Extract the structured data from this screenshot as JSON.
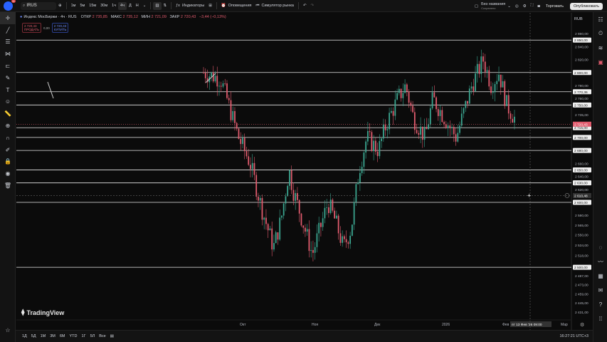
{
  "topbar": {
    "notif_badge": "11",
    "symbol": "IRUS",
    "timeframes": [
      "1м",
      "5м",
      "15м",
      "30м",
      "1ч",
      "4ч",
      "Д",
      "Н"
    ],
    "active_timeframe": "4ч",
    "indicators_label": "Индикаторы",
    "alerts_label": "Оповещения",
    "replay_label": "Симулятор рынка",
    "layout_name": "Без названия",
    "layout_status": "Сохранено",
    "trade_label": "Торговать",
    "publish_label": "Опубликовать"
  },
  "legend": {
    "title": "Индекс МосБиржи · 4ч · RUS",
    "open_label": "ОТКР",
    "open": "2 735,85",
    "high_label": "МАКС",
    "high": "2 735,12",
    "low_label": "МИН",
    "low": "2 721,09",
    "close_label": "ЗАКР",
    "close": "2 720,43",
    "change": "−3,44 (−0,13%)"
  },
  "quote": {
    "sell_price": "2 720,43",
    "sell_label": "ПРОДАТЬ",
    "spread": "0,00",
    "buy_price": "2 720,43",
    "buy_label": "КУПИТЬ"
  },
  "price_scale": {
    "currency": "RUB",
    "ticks": [
      "2 860,00",
      "2 850,00",
      "2 840,00",
      "2 820,00",
      "2 800,00",
      "2 780,00",
      "2 770,36",
      "2 760,00",
      "2 750,00",
      "2 735,00",
      "2 715,00",
      "2 700,00",
      "2 680,00",
      "2 660,00",
      "2 650,00",
      "2 640,00",
      "2 630,00",
      "2 620,00",
      "2 600,00",
      "2 580,00",
      "2 565,00",
      "2 550,00",
      "2 534,00",
      "2 518,00",
      "2 500,00",
      "2 487,00",
      "2 473,00",
      "2 459,00",
      "2 445,00",
      "2 431,00"
    ],
    "current_price": "2 720,43",
    "crosshair_price": "2 610,48"
  },
  "time_axis": {
    "labels": [
      "Окт",
      "Ноя",
      "Дек",
      "2026",
      "Фев",
      "Мар"
    ],
    "crosshair_time": "пт 13 Фев '26  09:00"
  },
  "chart_data": {
    "type": "candlestick",
    "title": "",
    "ylim": [
      2420,
      2870
    ],
    "horizontal_levels": [
      2850,
      2800,
      2770.36,
      2750,
      2715,
      2700,
      2680,
      2650,
      2630,
      2600,
      2500
    ],
    "last_price": 2720.43,
    "crosshair_price": 2610.48
  },
  "watermark": "TradingView",
  "bottombar": {
    "ranges": [
      "1Д",
      "5Д",
      "1М",
      "3М",
      "6М",
      "YTD",
      "1Г",
      "5Л",
      "Все"
    ],
    "clock": "16:27:21 UTC+3"
  },
  "colors": {
    "up": "#3aa58f",
    "down": "#e05b6d",
    "background": "#0b0b0b",
    "level_line": "#e8e8e8",
    "accent": "#2962ff"
  }
}
